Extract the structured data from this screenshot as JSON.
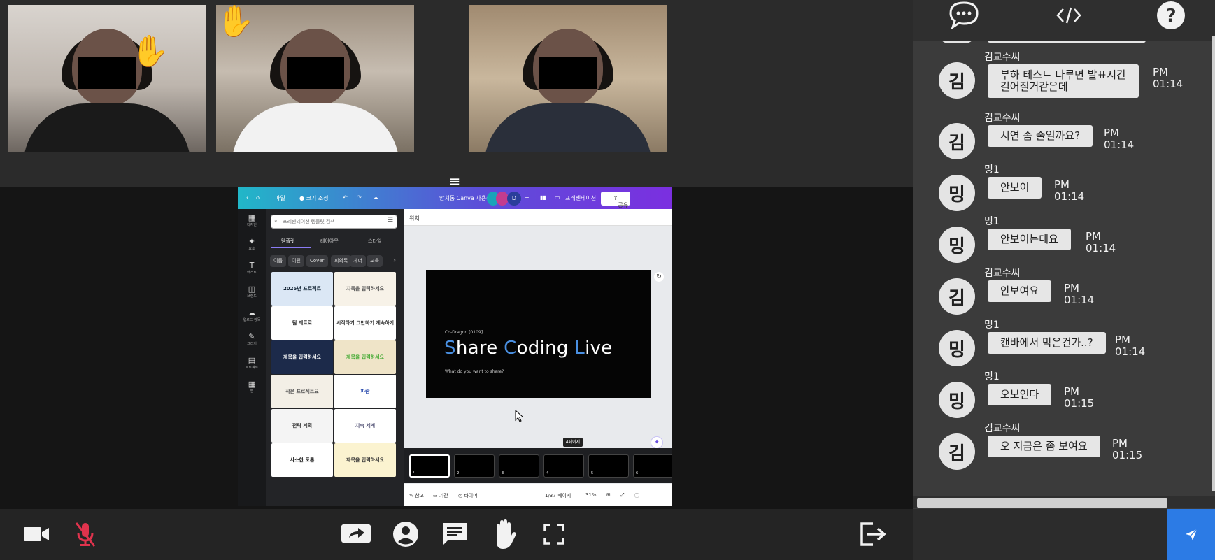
{
  "canva": {
    "topbar": {
      "file": "파일",
      "resize": "크기 조정",
      "title": "안쳐롱 Canva 사용해 보기",
      "avatar_initial": "D",
      "presentation": "프레젠테이션",
      "share": "공유"
    },
    "rail": [
      {
        "icon": "▦",
        "label": "디자인"
      },
      {
        "icon": "✦",
        "label": "요소"
      },
      {
        "icon": "T",
        "label": "텍스트"
      },
      {
        "icon": "◫",
        "label": "브랜드"
      },
      {
        "icon": "☁",
        "label": "업로드 항목"
      },
      {
        "icon": "✎",
        "label": "그리기"
      },
      {
        "icon": "▤",
        "label": "프로젝트"
      },
      {
        "icon": "▦",
        "label": "앱"
      }
    ],
    "search_placeholder": "프레젠테이션 템플릿 검색",
    "panel_tabs": [
      "템플릿",
      "레이아웃",
      "스타일"
    ],
    "chips": [
      "이름",
      "이원",
      "Cover",
      "회의록",
      "게더",
      "교육"
    ],
    "thumbs": [
      {
        "text": "2025년 프로젝트",
        "bg": "#dbe7f5",
        "fg": "#123"
      },
      {
        "text": "지목을 입력하세요",
        "bg": "#f7f2e8",
        "fg": "#555"
      },
      {
        "text": "팀 레트로",
        "bg": "#ffffff",
        "fg": "#111"
      },
      {
        "text": "시작하기 그만하기 계속하기",
        "bg": "#ffffff",
        "fg": "#333"
      },
      {
        "text": "제목을 입력하세요",
        "bg": "#1c2a4a",
        "fg": "#fff"
      },
      {
        "text": "제목을 입력하세요",
        "bg": "#efe4c8",
        "fg": "#4a3"
      },
      {
        "text": "작은 프로젝트요",
        "bg": "#f3efe6",
        "fg": "#555"
      },
      {
        "text": "파란",
        "bg": "#ffffff",
        "fg": "#2244aa"
      },
      {
        "text": "전략 계획",
        "bg": "#f4f4f4",
        "fg": "#333"
      },
      {
        "text": "지속 세계",
        "bg": "#ffffff",
        "fg": "#557"
      },
      {
        "text": "사소한 토론",
        "bg": "#ffffff",
        "fg": "#111"
      },
      {
        "text": "제목을 입력하세요",
        "bg": "#fbf3d0",
        "fg": "#333"
      }
    ],
    "main_bar": "위치",
    "slide": {
      "kicker": "Co-Dragon  [0109]",
      "title_parts": [
        "S",
        "hare ",
        "C",
        "oding ",
        "L",
        "ive"
      ],
      "subtitle": "What do you want to share?"
    },
    "page_label": "4페이지",
    "frames": [
      "1",
      "2",
      "3",
      "4",
      "5",
      "6"
    ],
    "bottom": {
      "notes": "참고",
      "duration": "기간",
      "timer": "타이머",
      "pages": "1/37 페이지",
      "zoom": "31%"
    }
  },
  "chat": {
    "header_icons": [
      "chat-bubble-icon",
      "code-icon",
      "help-icon"
    ],
    "input_placeholder": "",
    "messages": [
      {
        "name": "김교수씨",
        "avatar": "김",
        "text": [
          "부하 테스트 다루면 발표시간",
          "길어질거같은데"
        ],
        "time": [
          "PM",
          "01:14"
        ]
      },
      {
        "name": "김교수씨",
        "avatar": "김",
        "text": [
          "시연 좀 줄일까요?"
        ],
        "time": [
          "PM",
          "01:14"
        ]
      },
      {
        "name": "밍1",
        "avatar": "밍",
        "text": [
          "안보이"
        ],
        "time": [
          "PM",
          "01:14"
        ]
      },
      {
        "name": "밍1",
        "avatar": "밍",
        "text": [
          "안보이는데요"
        ],
        "time": [
          "PM",
          "01:14"
        ]
      },
      {
        "name": "김교수씨",
        "avatar": "김",
        "text": [
          "안보여요"
        ],
        "time": [
          "PM",
          "01:14"
        ]
      },
      {
        "name": "밍1",
        "avatar": "밍",
        "text": [
          "캔바에서 막은건가..?"
        ],
        "time": [
          "PM",
          "01:14"
        ]
      },
      {
        "name": "밍1",
        "avatar": "밍",
        "text": [
          "오보인다"
        ],
        "time": [
          "PM",
          "01:15"
        ]
      },
      {
        "name": "김교수씨",
        "avatar": "김",
        "text": [
          "오 지금은 좀 보여요"
        ],
        "time": [
          "PM",
          "01:15"
        ]
      }
    ]
  },
  "colors": {
    "accent": "#2c7be5",
    "muted_mic": "#e0334d",
    "chat_bg": "#3b3b3b",
    "bubble": "#e6e6e6"
  }
}
